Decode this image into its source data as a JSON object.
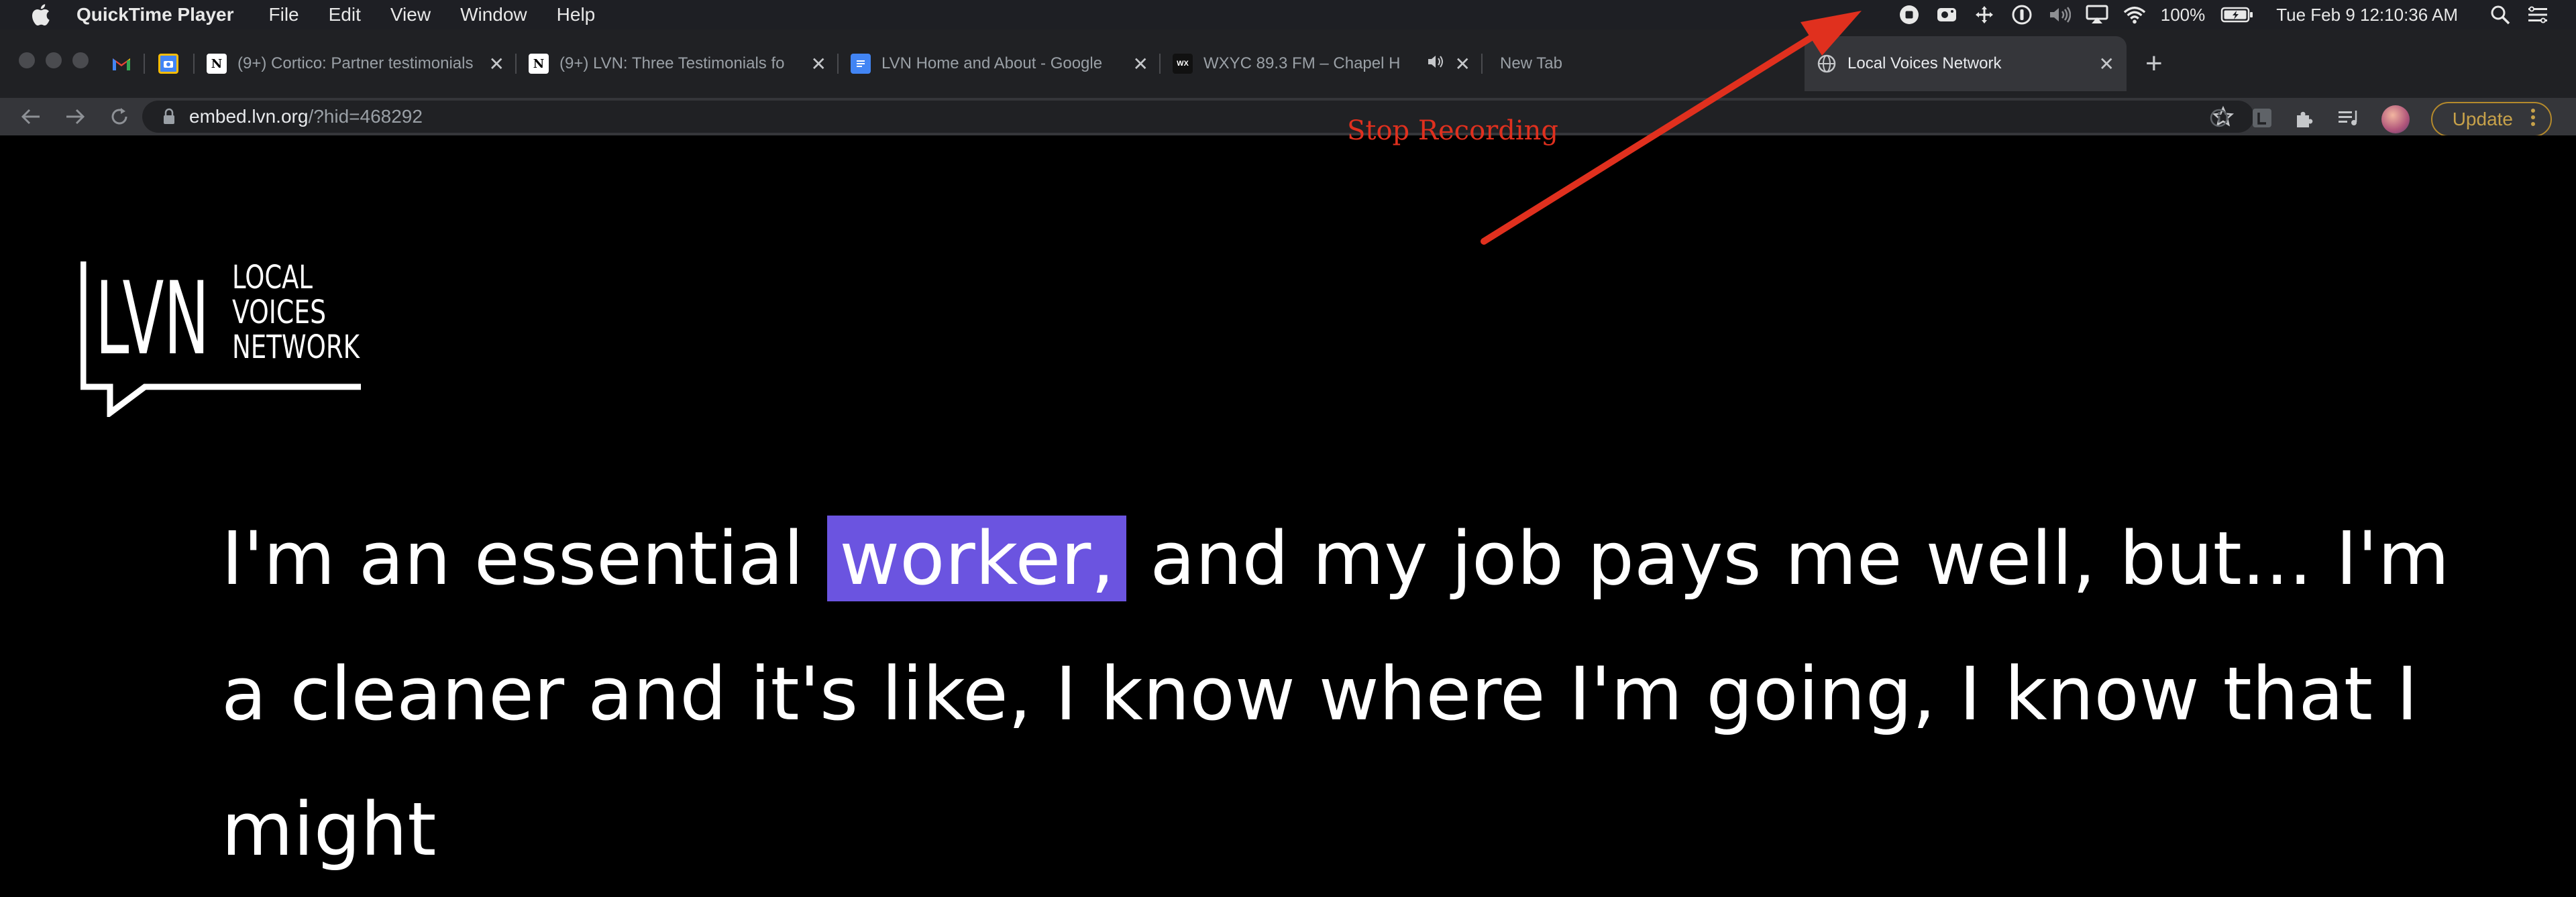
{
  "menubar": {
    "app_name": "QuickTime Player",
    "menus": [
      "File",
      "Edit",
      "View",
      "Window",
      "Help"
    ],
    "battery": "100%",
    "datetime": "Tue Feb 9  12:10:36 AM"
  },
  "tabs": [
    {
      "title": "",
      "favicon": "gmail-icon",
      "active": false
    },
    {
      "title": "",
      "favicon": "camera-app-icon",
      "active": false
    },
    {
      "title": "(9+) Cortico: Partner testimonials",
      "favicon": "notion-icon",
      "active": false
    },
    {
      "title": "(9+) LVN: Three Testimonials fo",
      "favicon": "notion-icon",
      "active": false
    },
    {
      "title": "LVN Home and About - Google",
      "favicon": "google-docs-icon",
      "active": false
    },
    {
      "title": "WXYC 89.3 FM – Chapel H",
      "favicon": "wxyc-icon",
      "active": false,
      "audio": true
    },
    {
      "title": "New Tab",
      "favicon": "",
      "active": false
    },
    {
      "title": "Local Voices Network",
      "favicon": "globe-icon",
      "active": true
    }
  ],
  "omnibox": {
    "domain": "embed.lvn.org",
    "path": "/?hid=468292"
  },
  "toolbar": {
    "update_label": "Update"
  },
  "logo": {
    "mark": "LVN",
    "line1": "LOCAL",
    "line2": "VOICES",
    "line3": "NETWORK"
  },
  "annotation": {
    "text": "Stop Recording",
    "color": "#e0301e"
  },
  "transcript": {
    "before": "I'm an essential ",
    "highlight": "worker,",
    "after": " and my job pays me well, but... I'm a cleaner and it's like, I know where I'm going, I know that I might",
    "highlight_color": "#6b54e0"
  }
}
